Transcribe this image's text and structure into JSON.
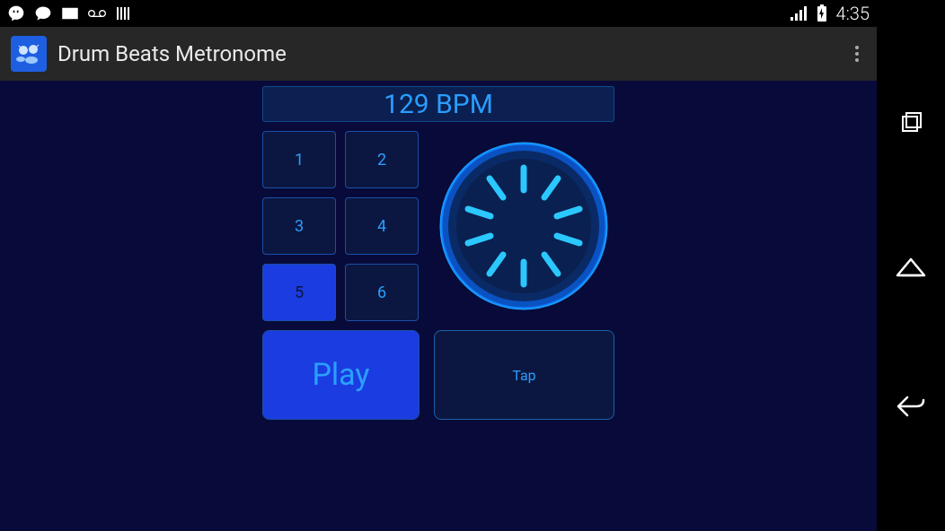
{
  "status": {
    "time": "4:35"
  },
  "app": {
    "title": "Drum Beats Metronome"
  },
  "bpm": {
    "value": 129,
    "display": "129 BPM"
  },
  "beats": {
    "items": [
      {
        "label": "1",
        "active": false
      },
      {
        "label": "2",
        "active": false
      },
      {
        "label": "3",
        "active": false
      },
      {
        "label": "4",
        "active": false
      },
      {
        "label": "5",
        "active": true
      },
      {
        "label": "6",
        "active": false
      }
    ]
  },
  "controls": {
    "play_label": "Play",
    "tap_label": "Tap"
  },
  "colors": {
    "bg": "#080a3a",
    "accent": "#2a9dff",
    "active": "#1b3ce0",
    "dial_glow": "#0a6eff"
  }
}
